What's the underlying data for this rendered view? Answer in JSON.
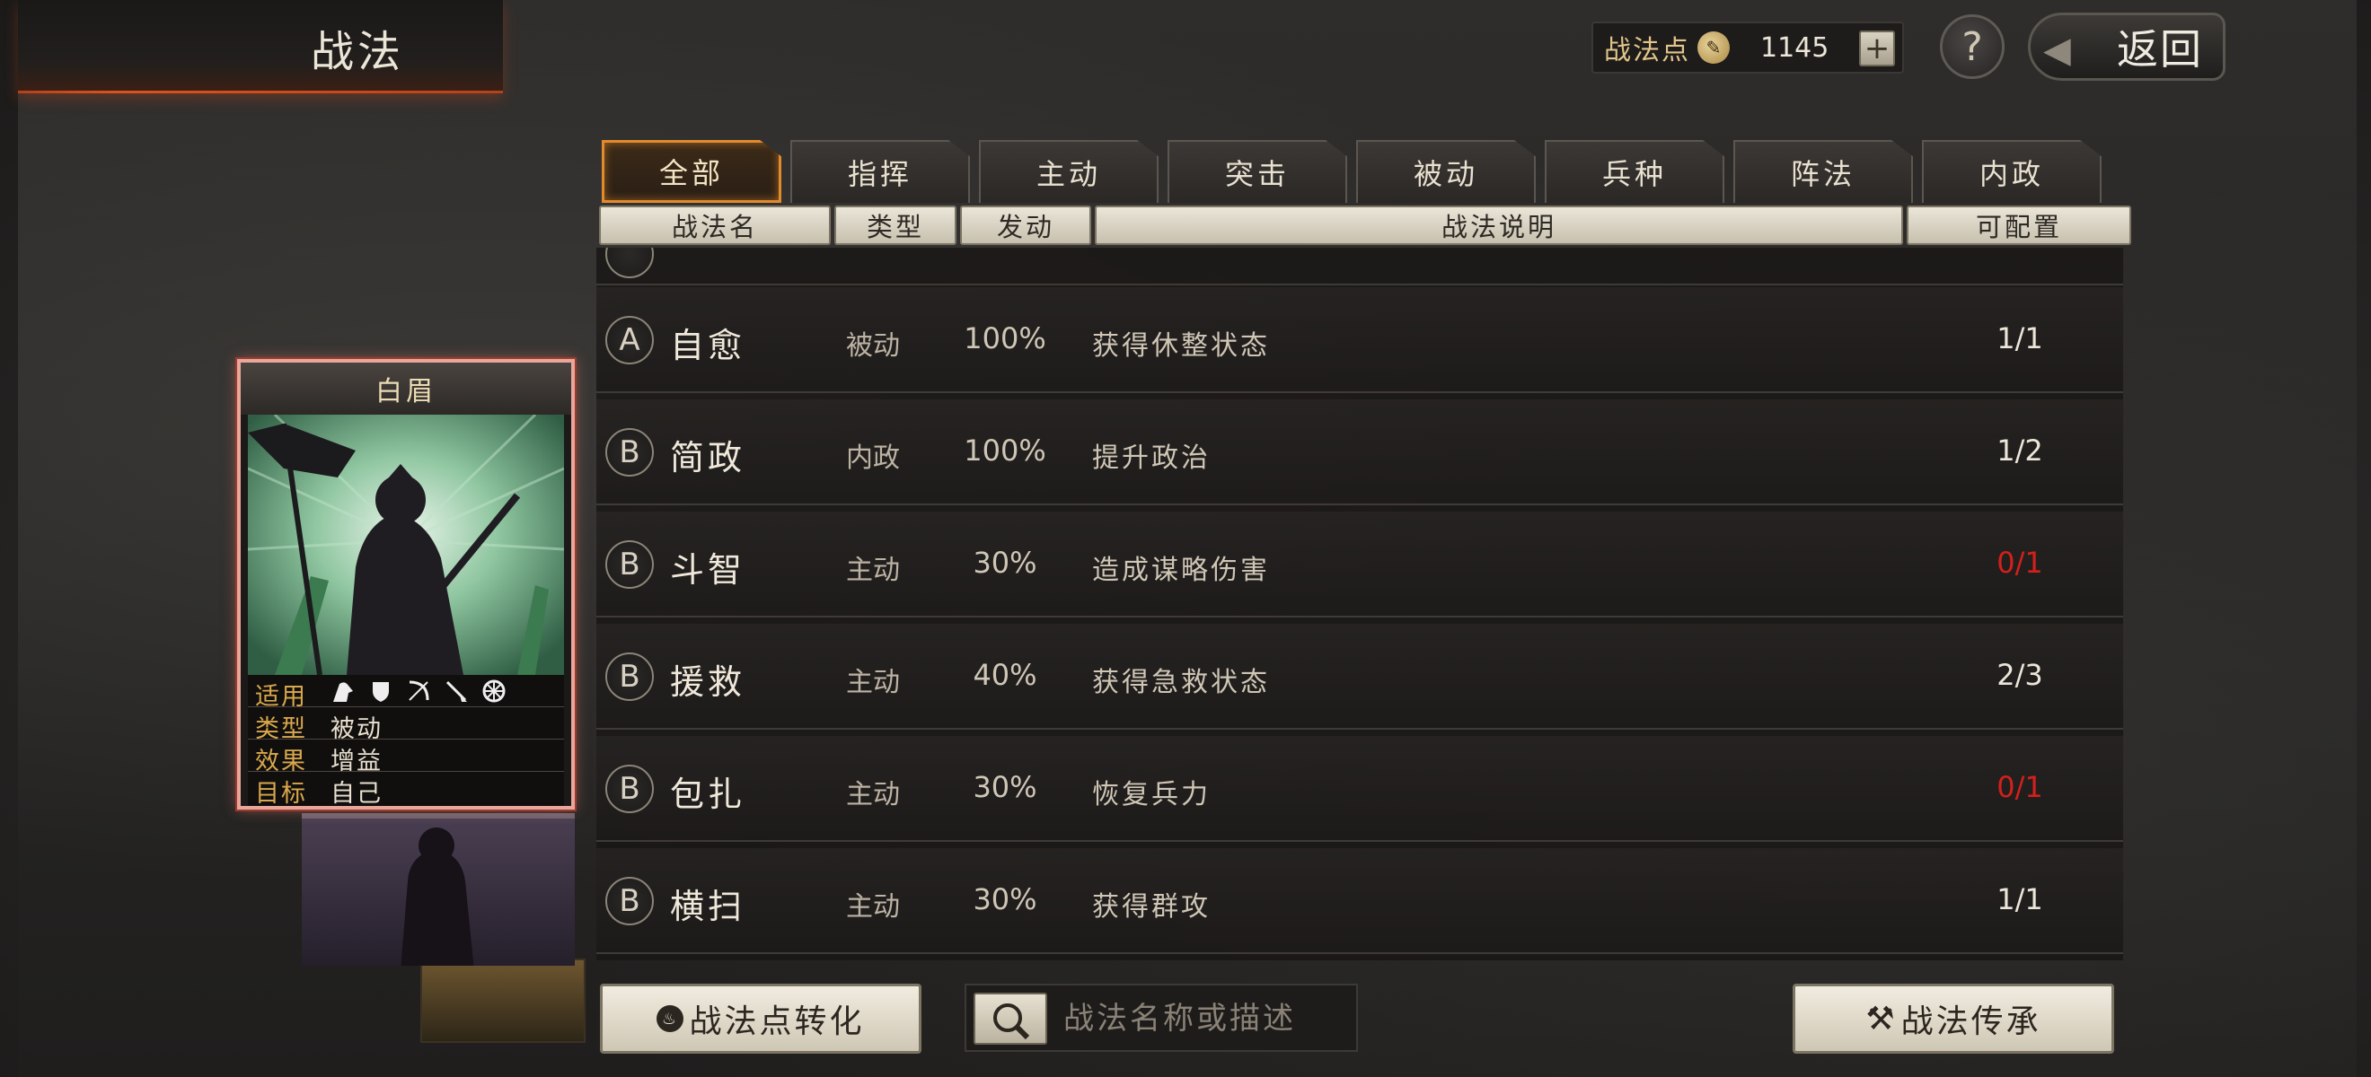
{
  "header": {
    "title": "战法",
    "points_label": "战法点",
    "points_value": "1145",
    "add_symbol": "+",
    "help_symbol": "?",
    "back_label": "返回"
  },
  "tabs": [
    {
      "label": "全部",
      "active": true
    },
    {
      "label": "指挥"
    },
    {
      "label": "主动"
    },
    {
      "label": "突击"
    },
    {
      "label": "被动"
    },
    {
      "label": "兵种"
    },
    {
      "label": "阵法"
    },
    {
      "label": "内政"
    }
  ],
  "columns": [
    "战法名",
    "类型",
    "发动",
    "战法说明",
    "可配置"
  ],
  "rows": [
    {
      "grade": "A",
      "name": "自愈",
      "type": "被动",
      "rate": "100%",
      "desc": "获得休整状态",
      "config": "1/1",
      "unavailable": false
    },
    {
      "grade": "B",
      "name": "简政",
      "type": "内政",
      "rate": "100%",
      "desc": "提升政治",
      "config": "1/2",
      "unavailable": false
    },
    {
      "grade": "B",
      "name": "斗智",
      "type": "主动",
      "rate": "30%",
      "desc": "造成谋略伤害",
      "config": "0/1",
      "unavailable": true
    },
    {
      "grade": "B",
      "name": "援救",
      "type": "主动",
      "rate": "40%",
      "desc": "获得急救状态",
      "config": "2/3",
      "unavailable": false
    },
    {
      "grade": "B",
      "name": "包扎",
      "type": "主动",
      "rate": "30%",
      "desc": "恢复兵力",
      "config": "0/1",
      "unavailable": true
    },
    {
      "grade": "B",
      "name": "横扫",
      "type": "主动",
      "rate": "30%",
      "desc": "获得群攻",
      "config": "1/1",
      "unavailable": false
    }
  ],
  "card": {
    "name": "白眉",
    "applies_label": "适用",
    "applies_icons": [
      "cavalry-icon",
      "shield-icon",
      "bow-icon",
      "spear-icon",
      "chariot-icon"
    ],
    "type_label": "类型",
    "type_value": "被动",
    "effect_label": "效果",
    "effect_value": "增益",
    "target_label": "目标",
    "target_value": "自己"
  },
  "bottom": {
    "convert_label": "战法点转化",
    "search_placeholder": "战法名称或描述",
    "inherit_label": "战法传承"
  },
  "colors": {
    "accent_orange": "#e38a2c",
    "warning_red": "#d2201c",
    "card_border": "#e9a69a"
  }
}
